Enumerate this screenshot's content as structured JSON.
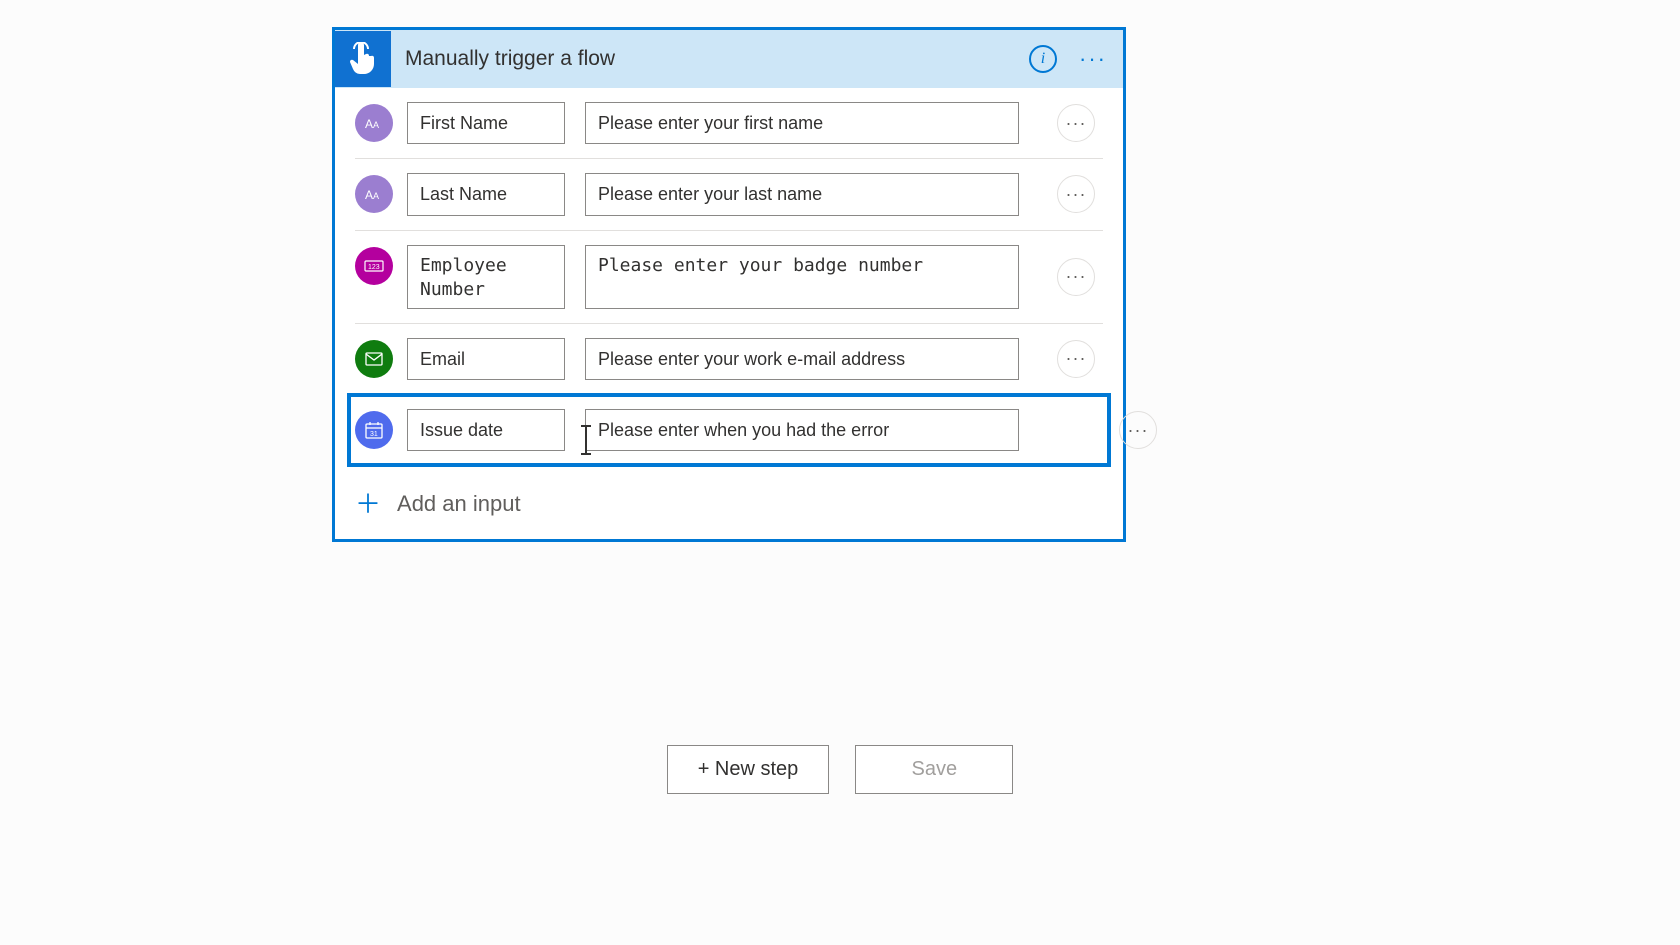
{
  "trigger": {
    "title": "Manually trigger a flow"
  },
  "inputs": [
    {
      "name": "First Name",
      "description": "Please enter your first name",
      "icon": "text",
      "highlighted": false
    },
    {
      "name": "Last Name",
      "description": "Please enter your last name",
      "icon": "text",
      "highlighted": false
    },
    {
      "name": "Employee Number",
      "description": "Please enter your badge number",
      "icon": "number",
      "highlighted": false
    },
    {
      "name": "Email",
      "description": "Please enter your work e-mail address",
      "icon": "email",
      "highlighted": false
    },
    {
      "name": "Issue date",
      "description": "Please enter when you had the error",
      "icon": "date",
      "highlighted": true
    }
  ],
  "addInputLabel": "Add an input",
  "buttons": {
    "newStep": "+ New step",
    "save": "Save"
  }
}
